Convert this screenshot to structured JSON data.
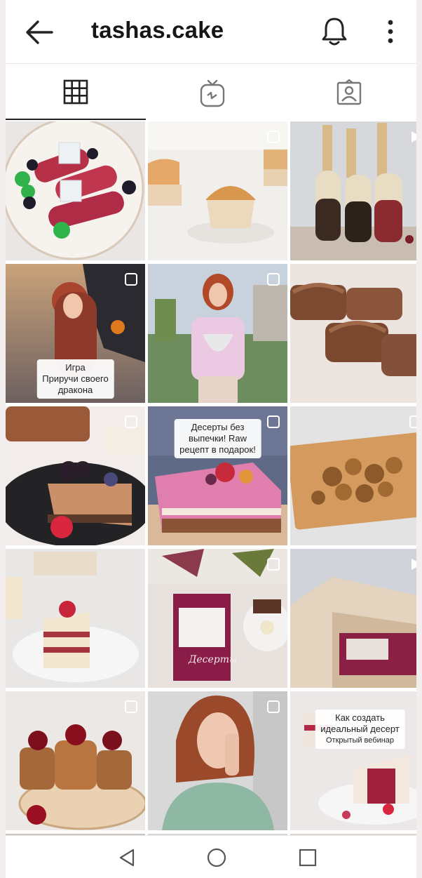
{
  "header": {
    "title": "tashas.cake",
    "icons": {
      "back": "arrow-left-icon",
      "notifications": "bell-icon",
      "menu": "more-vertical-icon"
    }
  },
  "tabs": [
    {
      "name": "grid",
      "icon": "grid-icon",
      "active": true
    },
    {
      "name": "igtv",
      "icon": "igtv-icon",
      "active": false
    },
    {
      "name": "tagged",
      "icon": "tagged-user-icon",
      "active": false
    }
  ],
  "posts": {
    "overlays": {
      "game": [
        "Игра",
        "Приручи своего",
        "дракона"
      ],
      "desserts": [
        "Десерты без",
        "выпечки! Raw",
        "рецепт в подарок!"
      ],
      "book": "Десерты",
      "webinar": [
        "Как создать",
        "идеальный десерт",
        "Открытый вебинар"
      ]
    }
  },
  "colors": {
    "accent": "#262626",
    "background": "#ffffff"
  },
  "bottom_nav": {
    "icons": [
      "back-triangle-icon",
      "home-circle-icon",
      "recents-square-icon"
    ]
  }
}
